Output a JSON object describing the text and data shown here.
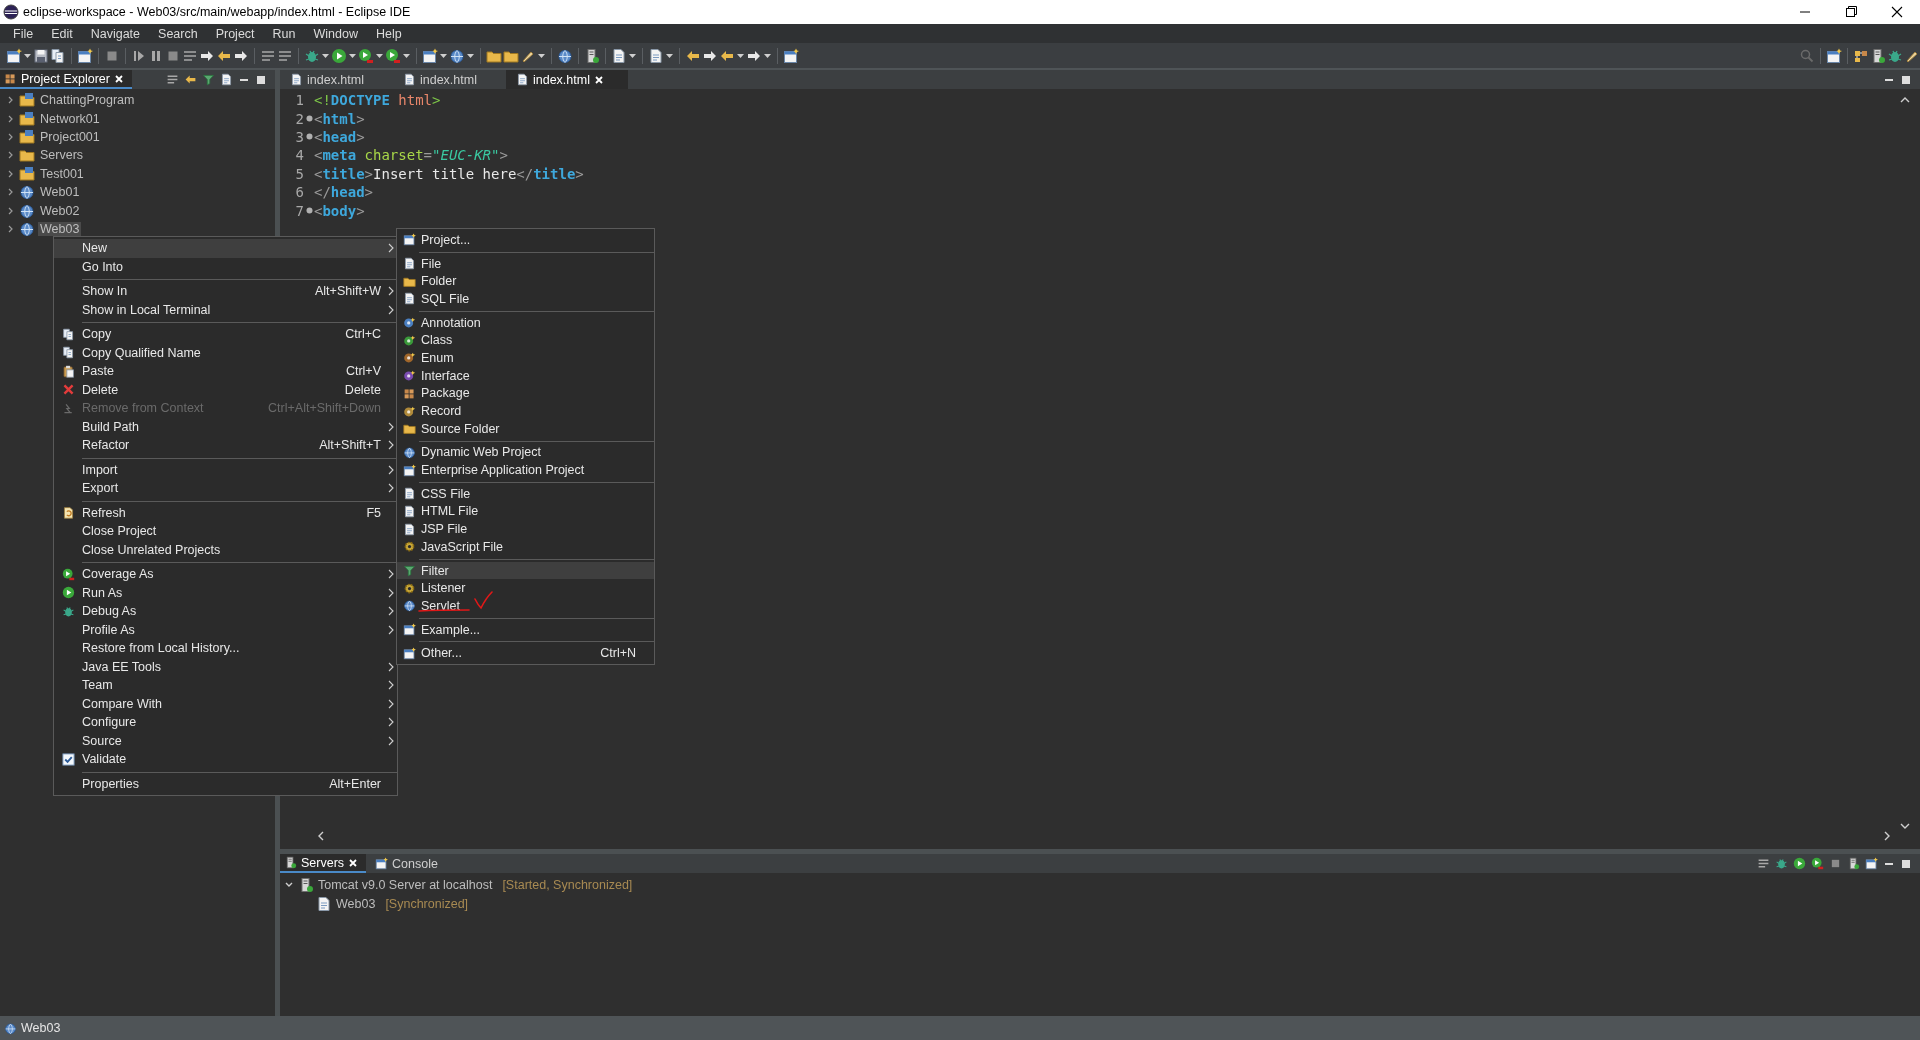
{
  "window": {
    "title": "eclipse-workspace - Web03/src/main/webapp/index.html - Eclipse IDE"
  },
  "menu_bar": [
    "File",
    "Edit",
    "Navigate",
    "Search",
    "Project",
    "Run",
    "Window",
    "Help"
  ],
  "project_explorer": {
    "tab": {
      "label": "Project Explorer",
      "selected": true
    },
    "items": [
      {
        "label": "ChattingProgram",
        "expanded": false,
        "selected": false
      },
      {
        "label": "Network01",
        "expanded": false,
        "selected": false
      },
      {
        "label": "Project001",
        "expanded": false,
        "selected": false
      },
      {
        "label": "Servers",
        "expanded": false,
        "selected": false
      },
      {
        "label": "Test001",
        "expanded": false,
        "selected": false
      },
      {
        "label": "Web01",
        "expanded": false,
        "selected": false
      },
      {
        "label": "Web02",
        "expanded": false,
        "selected": false
      },
      {
        "label": "Web03",
        "expanded": false,
        "selected": true
      }
    ]
  },
  "editor": {
    "tabs": [
      {
        "label": "index.html",
        "selected": false
      },
      {
        "label": "index.html",
        "selected": false
      },
      {
        "label": "index.html",
        "selected": true
      }
    ],
    "lines": [
      {
        "number": "1",
        "foldable": false,
        "tokens": [
          {
            "t": "<!",
            "kind": "decl"
          },
          {
            "t": "DOCTYPE",
            "kind": "tag"
          },
          {
            "t": " html",
            "kind": "doctype"
          },
          {
            "t": ">",
            "kind": "decl"
          }
        ]
      },
      {
        "number": "2",
        "foldable": true,
        "tokens": [
          {
            "t": "<",
            "kind": "punct"
          },
          {
            "t": "html",
            "kind": "tag"
          },
          {
            "t": ">",
            "kind": "punct"
          }
        ]
      },
      {
        "number": "3",
        "foldable": true,
        "tokens": [
          {
            "t": "<",
            "kind": "punct"
          },
          {
            "t": "head",
            "kind": "tag"
          },
          {
            "t": ">",
            "kind": "punct"
          }
        ]
      },
      {
        "number": "4",
        "foldable": false,
        "tokens": [
          {
            "t": "<",
            "kind": "punct"
          },
          {
            "t": "meta",
            "kind": "tag"
          },
          {
            "t": " charset",
            "kind": "attr"
          },
          {
            "t": "=",
            "kind": "punct"
          },
          {
            "t": "\"EUC-KR\"",
            "kind": "string"
          },
          {
            "t": ">",
            "kind": "punct"
          }
        ]
      },
      {
        "number": "5",
        "foldable": false,
        "tokens": [
          {
            "t": "<",
            "kind": "punct"
          },
          {
            "t": "title",
            "kind": "tag"
          },
          {
            "t": ">",
            "kind": "punct"
          },
          {
            "t": "Insert title here",
            "kind": "text"
          },
          {
            "t": "</",
            "kind": "punct"
          },
          {
            "t": "title",
            "kind": "tag"
          },
          {
            "t": ">",
            "kind": "punct"
          }
        ]
      },
      {
        "number": "6",
        "foldable": false,
        "tokens": [
          {
            "t": "</",
            "kind": "punct"
          },
          {
            "t": "head",
            "kind": "tag"
          },
          {
            "t": ">",
            "kind": "punct"
          }
        ]
      },
      {
        "number": "7",
        "foldable": true,
        "tokens": [
          {
            "t": "<",
            "kind": "punct"
          },
          {
            "t": "body",
            "kind": "tag"
          },
          {
            "t": ">",
            "kind": "punct"
          }
        ]
      }
    ]
  },
  "context_menu": [
    {
      "kind": "item",
      "label": "New",
      "submenu": true,
      "selected": true,
      "disabled": false
    },
    {
      "kind": "item",
      "label": "Go Into",
      "submenu": false,
      "selected": false,
      "disabled": false
    },
    {
      "kind": "separator"
    },
    {
      "kind": "item",
      "label": "Show In",
      "shortcut": "Alt+Shift+W",
      "submenu": true,
      "selected": false,
      "disabled": false
    },
    {
      "kind": "item",
      "label": "Show in Local Terminal",
      "submenu": true,
      "selected": false,
      "disabled": false
    },
    {
      "kind": "separator"
    },
    {
      "kind": "item",
      "label": "Copy",
      "shortcut": "Ctrl+C",
      "submenu": false,
      "selected": false,
      "disabled": false
    },
    {
      "kind": "item",
      "label": "Copy Qualified Name",
      "submenu": false,
      "selected": false,
      "disabled": false
    },
    {
      "kind": "item",
      "label": "Paste",
      "shortcut": "Ctrl+V",
      "submenu": false,
      "selected": false,
      "disabled": false
    },
    {
      "kind": "item",
      "label": "Delete",
      "shortcut": "Delete",
      "submenu": false,
      "selected": false,
      "disabled": false
    },
    {
      "kind": "item",
      "label": "Remove from Context",
      "shortcut": "Ctrl+Alt+Shift+Down",
      "submenu": false,
      "selected": false,
      "disabled": true
    },
    {
      "kind": "item",
      "label": "Build Path",
      "submenu": true,
      "selected": false,
      "disabled": false
    },
    {
      "kind": "item",
      "label": "Refactor",
      "shortcut": "Alt+Shift+T",
      "submenu": true,
      "selected": false,
      "disabled": false
    },
    {
      "kind": "separator"
    },
    {
      "kind": "item",
      "label": "Import",
      "submenu": true,
      "selected": false,
      "disabled": false
    },
    {
      "kind": "item",
      "label": "Export",
      "submenu": true,
      "selected": false,
      "disabled": false
    },
    {
      "kind": "separator"
    },
    {
      "kind": "item",
      "label": "Refresh",
      "shortcut": "F5",
      "submenu": false,
      "selected": false,
      "disabled": false
    },
    {
      "kind": "item",
      "label": "Close Project",
      "submenu": false,
      "selected": false,
      "disabled": false
    },
    {
      "kind": "item",
      "label": "Close Unrelated Projects",
      "submenu": false,
      "selected": false,
      "disabled": false
    },
    {
      "kind": "separator"
    },
    {
      "kind": "item",
      "label": "Coverage As",
      "submenu": true,
      "selected": false,
      "disabled": false
    },
    {
      "kind": "item",
      "label": "Run As",
      "submenu": true,
      "selected": false,
      "disabled": false
    },
    {
      "kind": "item",
      "label": "Debug As",
      "submenu": true,
      "selected": false,
      "disabled": false
    },
    {
      "kind": "item",
      "label": "Profile As",
      "submenu": true,
      "selected": false,
      "disabled": false
    },
    {
      "kind": "item",
      "label": "Restore from Local History...",
      "submenu": false,
      "selected": false,
      "disabled": false
    },
    {
      "kind": "item",
      "label": "Java EE Tools",
      "submenu": true,
      "selected": false,
      "disabled": false
    },
    {
      "kind": "item",
      "label": "Team",
      "submenu": true,
      "selected": false,
      "disabled": false
    },
    {
      "kind": "item",
      "label": "Compare With",
      "submenu": true,
      "selected": false,
      "disabled": false
    },
    {
      "kind": "item",
      "label": "Configure",
      "submenu": true,
      "selected": false,
      "disabled": false
    },
    {
      "kind": "item",
      "label": "Source",
      "submenu": true,
      "selected": false,
      "disabled": false
    },
    {
      "kind": "item",
      "label": "Validate",
      "checked": true,
      "submenu": false,
      "selected": false,
      "disabled": false
    },
    {
      "kind": "separator"
    },
    {
      "kind": "item",
      "label": "Properties",
      "shortcut": "Alt+Enter",
      "submenu": false,
      "selected": false,
      "disabled": false
    }
  ],
  "new_submenu": [
    {
      "kind": "item",
      "label": "Project...",
      "selected": false
    },
    {
      "kind": "separator"
    },
    {
      "kind": "item",
      "label": "File",
      "selected": false
    },
    {
      "kind": "item",
      "label": "Folder",
      "selected": false
    },
    {
      "kind": "item",
      "label": "SQL File",
      "selected": false
    },
    {
      "kind": "separator"
    },
    {
      "kind": "item",
      "label": "Annotation",
      "selected": false
    },
    {
      "kind": "item",
      "label": "Class",
      "selected": false
    },
    {
      "kind": "item",
      "label": "Enum",
      "selected": false
    },
    {
      "kind": "item",
      "label": "Interface",
      "selected": false
    },
    {
      "kind": "item",
      "label": "Package",
      "selected": false
    },
    {
      "kind": "item",
      "label": "Record",
      "selected": false
    },
    {
      "kind": "item",
      "label": "Source Folder",
      "selected": false
    },
    {
      "kind": "separator"
    },
    {
      "kind": "item",
      "label": "Dynamic Web Project",
      "selected": false
    },
    {
      "kind": "item",
      "label": "Enterprise Application Project",
      "selected": false
    },
    {
      "kind": "separator"
    },
    {
      "kind": "item",
      "label": "CSS File",
      "selected": false
    },
    {
      "kind": "item",
      "label": "HTML File",
      "selected": false
    },
    {
      "kind": "item",
      "label": "JSP File",
      "selected": false
    },
    {
      "kind": "item",
      "label": "JavaScript File",
      "selected": false
    },
    {
      "kind": "separator"
    },
    {
      "kind": "item",
      "label": "Filter",
      "selected": true
    },
    {
      "kind": "item",
      "label": "Listener",
      "selected": false
    },
    {
      "kind": "item",
      "label": "Servlet",
      "selected": false
    },
    {
      "kind": "separator"
    },
    {
      "kind": "item",
      "label": "Example...",
      "selected": false
    },
    {
      "kind": "separator"
    },
    {
      "kind": "item",
      "label": "Other...",
      "shortcut": "Ctrl+N",
      "selected": false
    }
  ],
  "bottom_panel": {
    "tabs": [
      {
        "label": "Servers",
        "selected": true
      },
      {
        "label": "Console",
        "selected": false
      }
    ],
    "servers": [
      {
        "label": "Tomcat v9.0 Server at localhost",
        "status": "[Started, Synchronized]",
        "expanded": true,
        "children": [
          {
            "label": "Web03",
            "status": "[Synchronized]"
          }
        ]
      }
    ]
  },
  "status_bar": {
    "text": "Web03"
  }
}
